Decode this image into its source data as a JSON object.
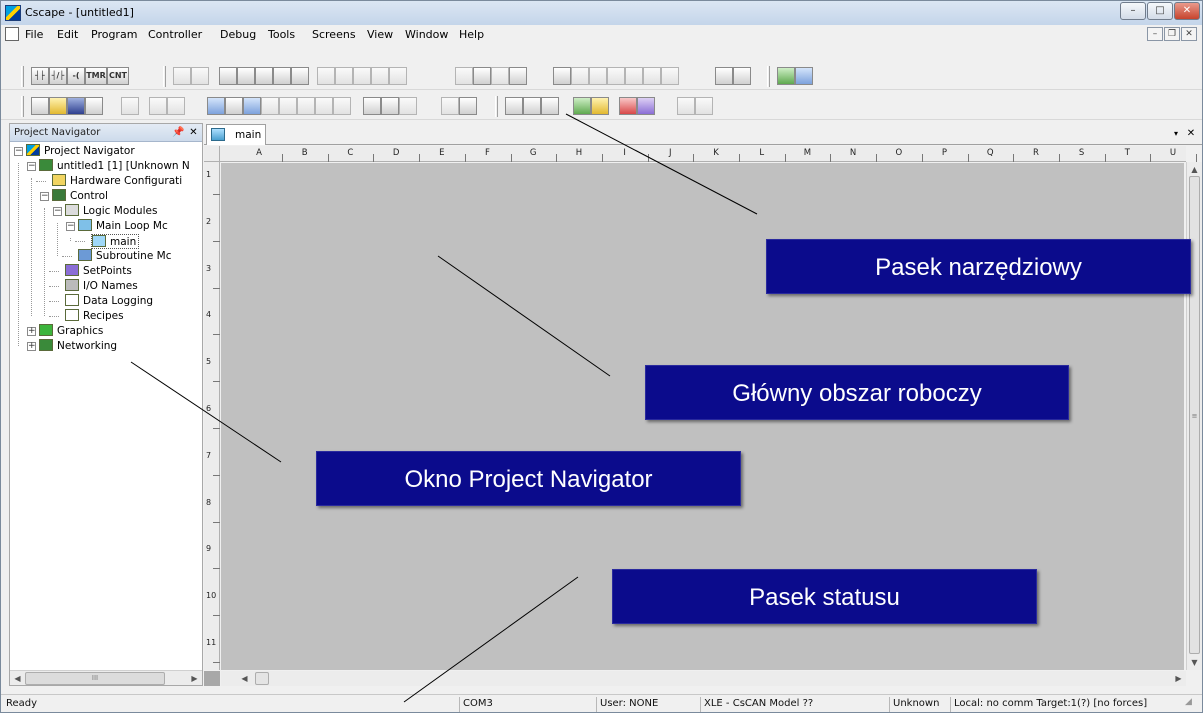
{
  "window": {
    "title": "Cscape - [untitled1]",
    "controls": {
      "minimize": "–",
      "maximize": "□",
      "close": "✕"
    }
  },
  "menubar": {
    "items": [
      "File",
      "Edit",
      "Program",
      "Controller",
      "Debug",
      "Tools",
      "Screens",
      "View",
      "Window",
      "Help"
    ],
    "mdi_controls": {
      "minimize": "–",
      "restore": "❐",
      "close": "✕"
    }
  },
  "toolbar1": {
    "icons": [
      {
        "name": "contact-no-icon",
        "glyph": "┤├"
      },
      {
        "name": "contact-nc-icon",
        "glyph": "┤/├"
      },
      {
        "name": "coil-icon",
        "glyph": "-( )-"
      },
      {
        "name": "timer-icon",
        "glyph": "TMR"
      },
      {
        "name": "counter-icon",
        "glyph": "CNT"
      }
    ]
  },
  "project_navigator": {
    "title": "Project Navigator",
    "pin": "📌",
    "close": "✕",
    "tree": [
      {
        "label": "Project Navigator",
        "level": 0,
        "expander": "−",
        "icon": "project-navigator-icon"
      },
      {
        "label": "untitled1 [1] [Unknown N",
        "level": 1,
        "expander": "−",
        "icon": "controller-icon"
      },
      {
        "label": "Hardware Configurati",
        "level": 2,
        "expander": "",
        "icon": "hardware-config-icon"
      },
      {
        "label": "Control",
        "level": 2,
        "expander": "−",
        "icon": "control-icon"
      },
      {
        "label": "Logic Modules",
        "level": 3,
        "expander": "−",
        "icon": "logic-modules-icon"
      },
      {
        "label": "Main Loop Mc",
        "level": 4,
        "expander": "−",
        "icon": "main-loop-icon"
      },
      {
        "label": "main",
        "level": 5,
        "expander": "",
        "icon": "ladder-icon",
        "selected": true
      },
      {
        "label": "Subroutine Mc",
        "level": 4,
        "expander": "",
        "icon": "subroutine-icon"
      },
      {
        "label": "SetPoints",
        "level": 3,
        "expander": "",
        "icon": "setpoints-icon"
      },
      {
        "label": "I/O Names",
        "level": 3,
        "expander": "",
        "icon": "io-names-icon"
      },
      {
        "label": "Data Logging",
        "level": 3,
        "expander": "",
        "icon": "data-logging-icon"
      },
      {
        "label": "Recipes",
        "level": 3,
        "expander": "",
        "icon": "recipes-icon"
      },
      {
        "label": "Graphics",
        "level": 1,
        "expander": "+",
        "icon": "graphics-icon"
      },
      {
        "label": "Networking",
        "level": 1,
        "expander": "+",
        "icon": "networking-icon"
      }
    ],
    "hscroll_thumb": "III"
  },
  "document": {
    "tab": "main",
    "tab_menu": "▾",
    "tab_close": "✕",
    "columns": [
      "A",
      "B",
      "C",
      "D",
      "E",
      "F",
      "G",
      "H",
      "I",
      "J",
      "K",
      "L",
      "M",
      "N",
      "O",
      "P",
      "Q",
      "R",
      "S",
      "T",
      "U"
    ],
    "rows": [
      "1",
      "2",
      "3",
      "4",
      "5",
      "6",
      "7",
      "8",
      "9",
      "10",
      "11"
    ]
  },
  "statusbar": {
    "ready": "Ready",
    "port": "COM3",
    "user": "User: NONE",
    "model": "XLE - CsCAN Model ??",
    "unknown": "Unknown",
    "connection": "Local: no comm  Target:1(?) [no forces]"
  },
  "callouts": {
    "toolbar": "Pasek narzędziowy",
    "workspace": "Główny obszar roboczy",
    "navigator": "Okno Project Navigator",
    "status": "Pasek statusu"
  },
  "colors": {
    "callout_bg": "#0b0b8c",
    "canvas_bg": "#c0c0c0",
    "titlebar": "#c4d5ea"
  }
}
